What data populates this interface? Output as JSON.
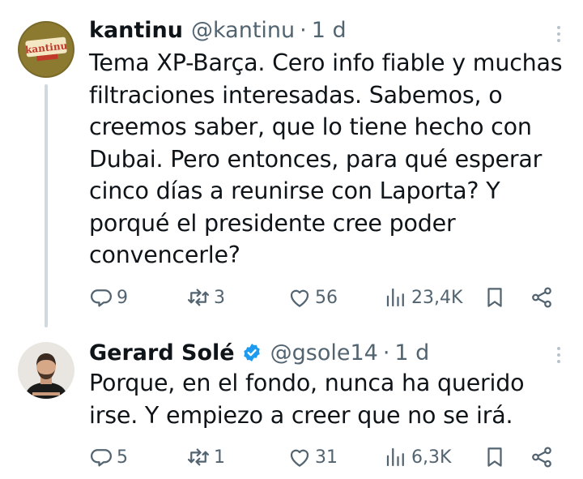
{
  "tweets": [
    {
      "author_name": "kantinu",
      "handle": "@kantinu",
      "separator": "·",
      "time": "1 d",
      "avatar_text": "kantinu",
      "text": "Tema XP-Barça. Cero info fiable y muchas\nfiltraciones interesadas. Sabemos, o\ncreemos saber, que lo tiene hecho con\nDubai. Pero entonces, para qué esperar\ncinco días a reunirse con Laporta? Y\nporqué el presidente cree poder\nconvencerle?",
      "replies": "9",
      "retweets": "3",
      "likes": "56",
      "views": "23,4K"
    },
    {
      "author_name": "Gerard Solé",
      "verified": true,
      "handle": "@gsole14",
      "separator": "·",
      "time": "1 d",
      "text": "Porque, en el fondo, nunca ha querido\nirse. Y empiezo a creer que no se irá.",
      "replies": "5",
      "retweets": "1",
      "likes": "31",
      "views": "6,3K"
    }
  ],
  "colors": {
    "text_primary": "#0f1419",
    "text_secondary": "#536471",
    "verified_blue": "#1d9bf0",
    "thread_line": "#cfd9de"
  },
  "icons": [
    "reply-icon",
    "retweet-icon",
    "like-icon",
    "views-icon",
    "bookmark-icon",
    "share-icon",
    "more-icon",
    "verified-badge-icon"
  ]
}
